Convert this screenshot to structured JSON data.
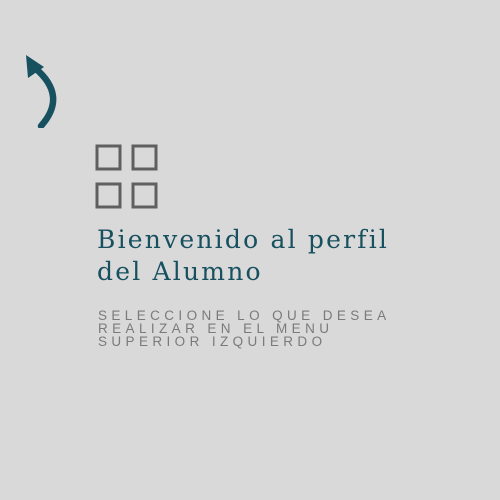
{
  "icons": {
    "back": "back-arrow-icon",
    "menu": "grid-icon"
  },
  "colors": {
    "background": "#d9d9d9",
    "accent": "#17505f",
    "icon_gray": "#5f5f5f",
    "subtitle_gray": "#7a7a7a"
  },
  "welcome": {
    "title_lines": [
      "Bienvenido al perfil",
      "del Alumno"
    ],
    "instruction_lines": [
      "SELECCIONE LO QUE DESEA",
      "REALIZAR EN EL MENU",
      "SUPERIOR IZQUIERDO"
    ]
  }
}
